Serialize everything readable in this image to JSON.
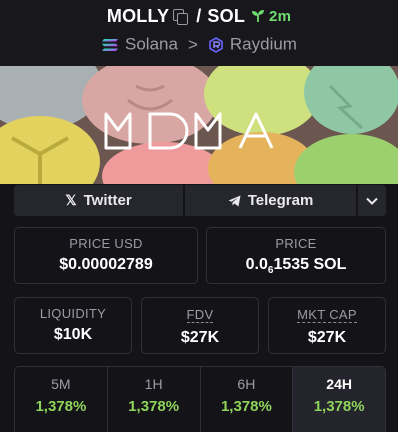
{
  "header": {
    "symbol": "MOLLY",
    "quote": "SOL",
    "slash": "/",
    "age": "2m",
    "chain": "Solana",
    "chevron": ">",
    "dex": "Raydium"
  },
  "banner": {
    "logo_text": "MDMA"
  },
  "socials": {
    "twitter_label": "Twitter",
    "telegram_label": "Telegram"
  },
  "stats": {
    "price_usd_label": "PRICE USD",
    "price_usd_value": "$0.00002789",
    "price_native_label": "PRICE",
    "price_native_prefix": "0.0",
    "price_native_zeros": "6",
    "price_native_digits": "1535 SOL",
    "liquidity_label": "LIQUIDITY",
    "liquidity_value": "$10K",
    "fdv_label": "FDV",
    "fdv_value": "$27K",
    "mcap_label": "MKT CAP",
    "mcap_value": "$27K"
  },
  "timeframes": [
    {
      "label": "5M",
      "value": "1,378%"
    },
    {
      "label": "1H",
      "value": "1,378%"
    },
    {
      "label": "6H",
      "value": "1,378%"
    },
    {
      "label": "24H",
      "value": "1,378%"
    }
  ],
  "active_timeframe": "24H",
  "colors": {
    "positive": "#8fd45a",
    "age_green": "#6fdc6f",
    "background": "#141418"
  }
}
